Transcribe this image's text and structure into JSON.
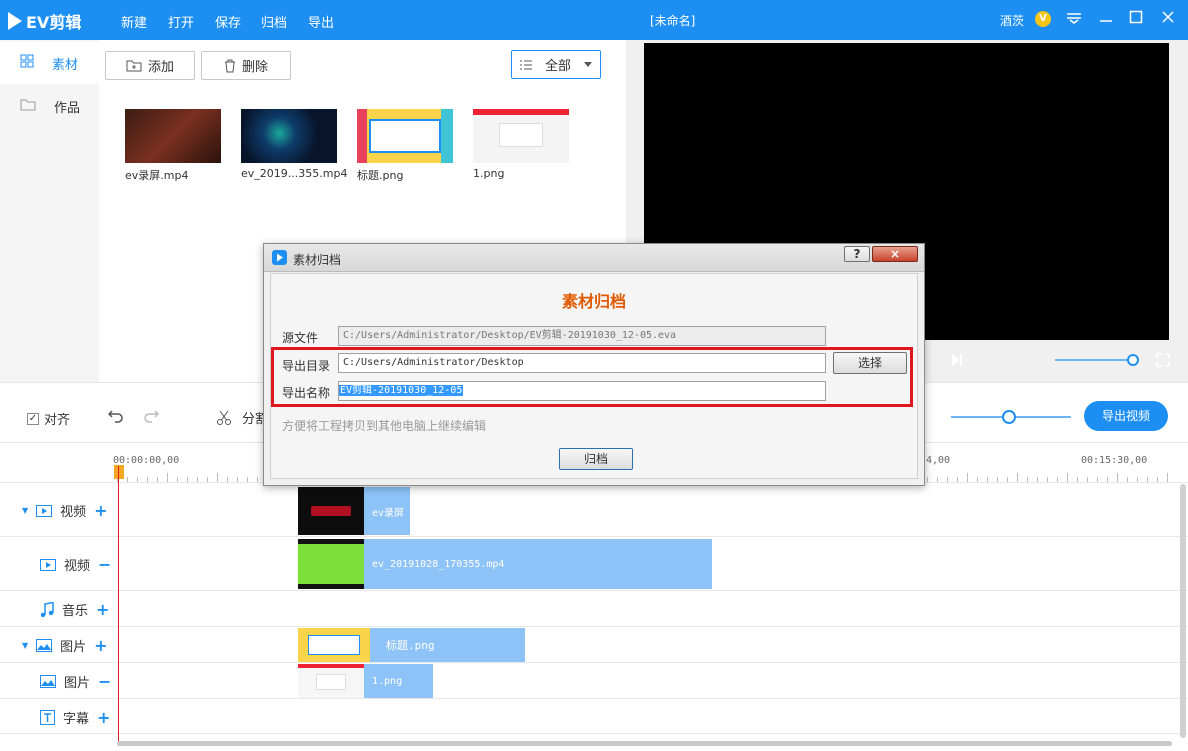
{
  "app": {
    "logo_text": "EV剪辑",
    "menu": [
      "新建",
      "打开",
      "保存",
      "归档",
      "导出"
    ],
    "doc_title": "[未命名]",
    "user_name": "酒茨",
    "vip_badge": "V"
  },
  "sidebar": {
    "items": [
      {
        "label": "素材",
        "icon": "grid-icon",
        "active": true
      },
      {
        "label": "作品",
        "icon": "folder-icon",
        "active": false
      }
    ]
  },
  "materials": {
    "add_label": "添加",
    "delete_label": "删除",
    "filter_label": "全部",
    "items": [
      {
        "label": "ev录屏.mp4"
      },
      {
        "label": "ev_2019...355.mp4"
      },
      {
        "label": "标题.png"
      },
      {
        "label": "1.png"
      }
    ]
  },
  "toolbar": {
    "align_label": "对齐",
    "split_label": "分割",
    "export_label": "导出视频"
  },
  "ruler": {
    "ticks": [
      "00:00:00,00",
      "00:15:30,00"
    ],
    "partial_tick": "4,00"
  },
  "tracks": [
    {
      "label": "视频",
      "action": "+",
      "clip": "ev录屏"
    },
    {
      "label": "视频",
      "action": "−",
      "clip": "ev_20191028_170355.mp4"
    },
    {
      "label": "音乐",
      "action": "+"
    },
    {
      "label": "图片",
      "action": "+",
      "clip": "标题.png"
    },
    {
      "label": "图片",
      "action": "−",
      "clip": "1.png"
    },
    {
      "label": "字幕",
      "action": "+"
    }
  ],
  "dialog": {
    "title": "素材归档",
    "heading": "素材归档",
    "help": "?",
    "close": "×",
    "source_label": "源文件",
    "source_value": "C:/Users/Administrator/Desktop/EV剪辑-20191030_12-05.eva",
    "dir_label": "导出目录",
    "dir_value": "C:/Users/Administrator/Desktop",
    "choose_label": "选择",
    "name_label": "导出名称",
    "name_value": "EV剪辑-20191030_12-05",
    "hint": "方便将工程拷贝到其他电脑上继续编辑",
    "archive_label": "归档"
  },
  "colors": {
    "accent": "#1e8ff2",
    "highlight_border": "#e0161f",
    "dialog_heading": "#e05a00",
    "clip": "#8ec3f8"
  }
}
